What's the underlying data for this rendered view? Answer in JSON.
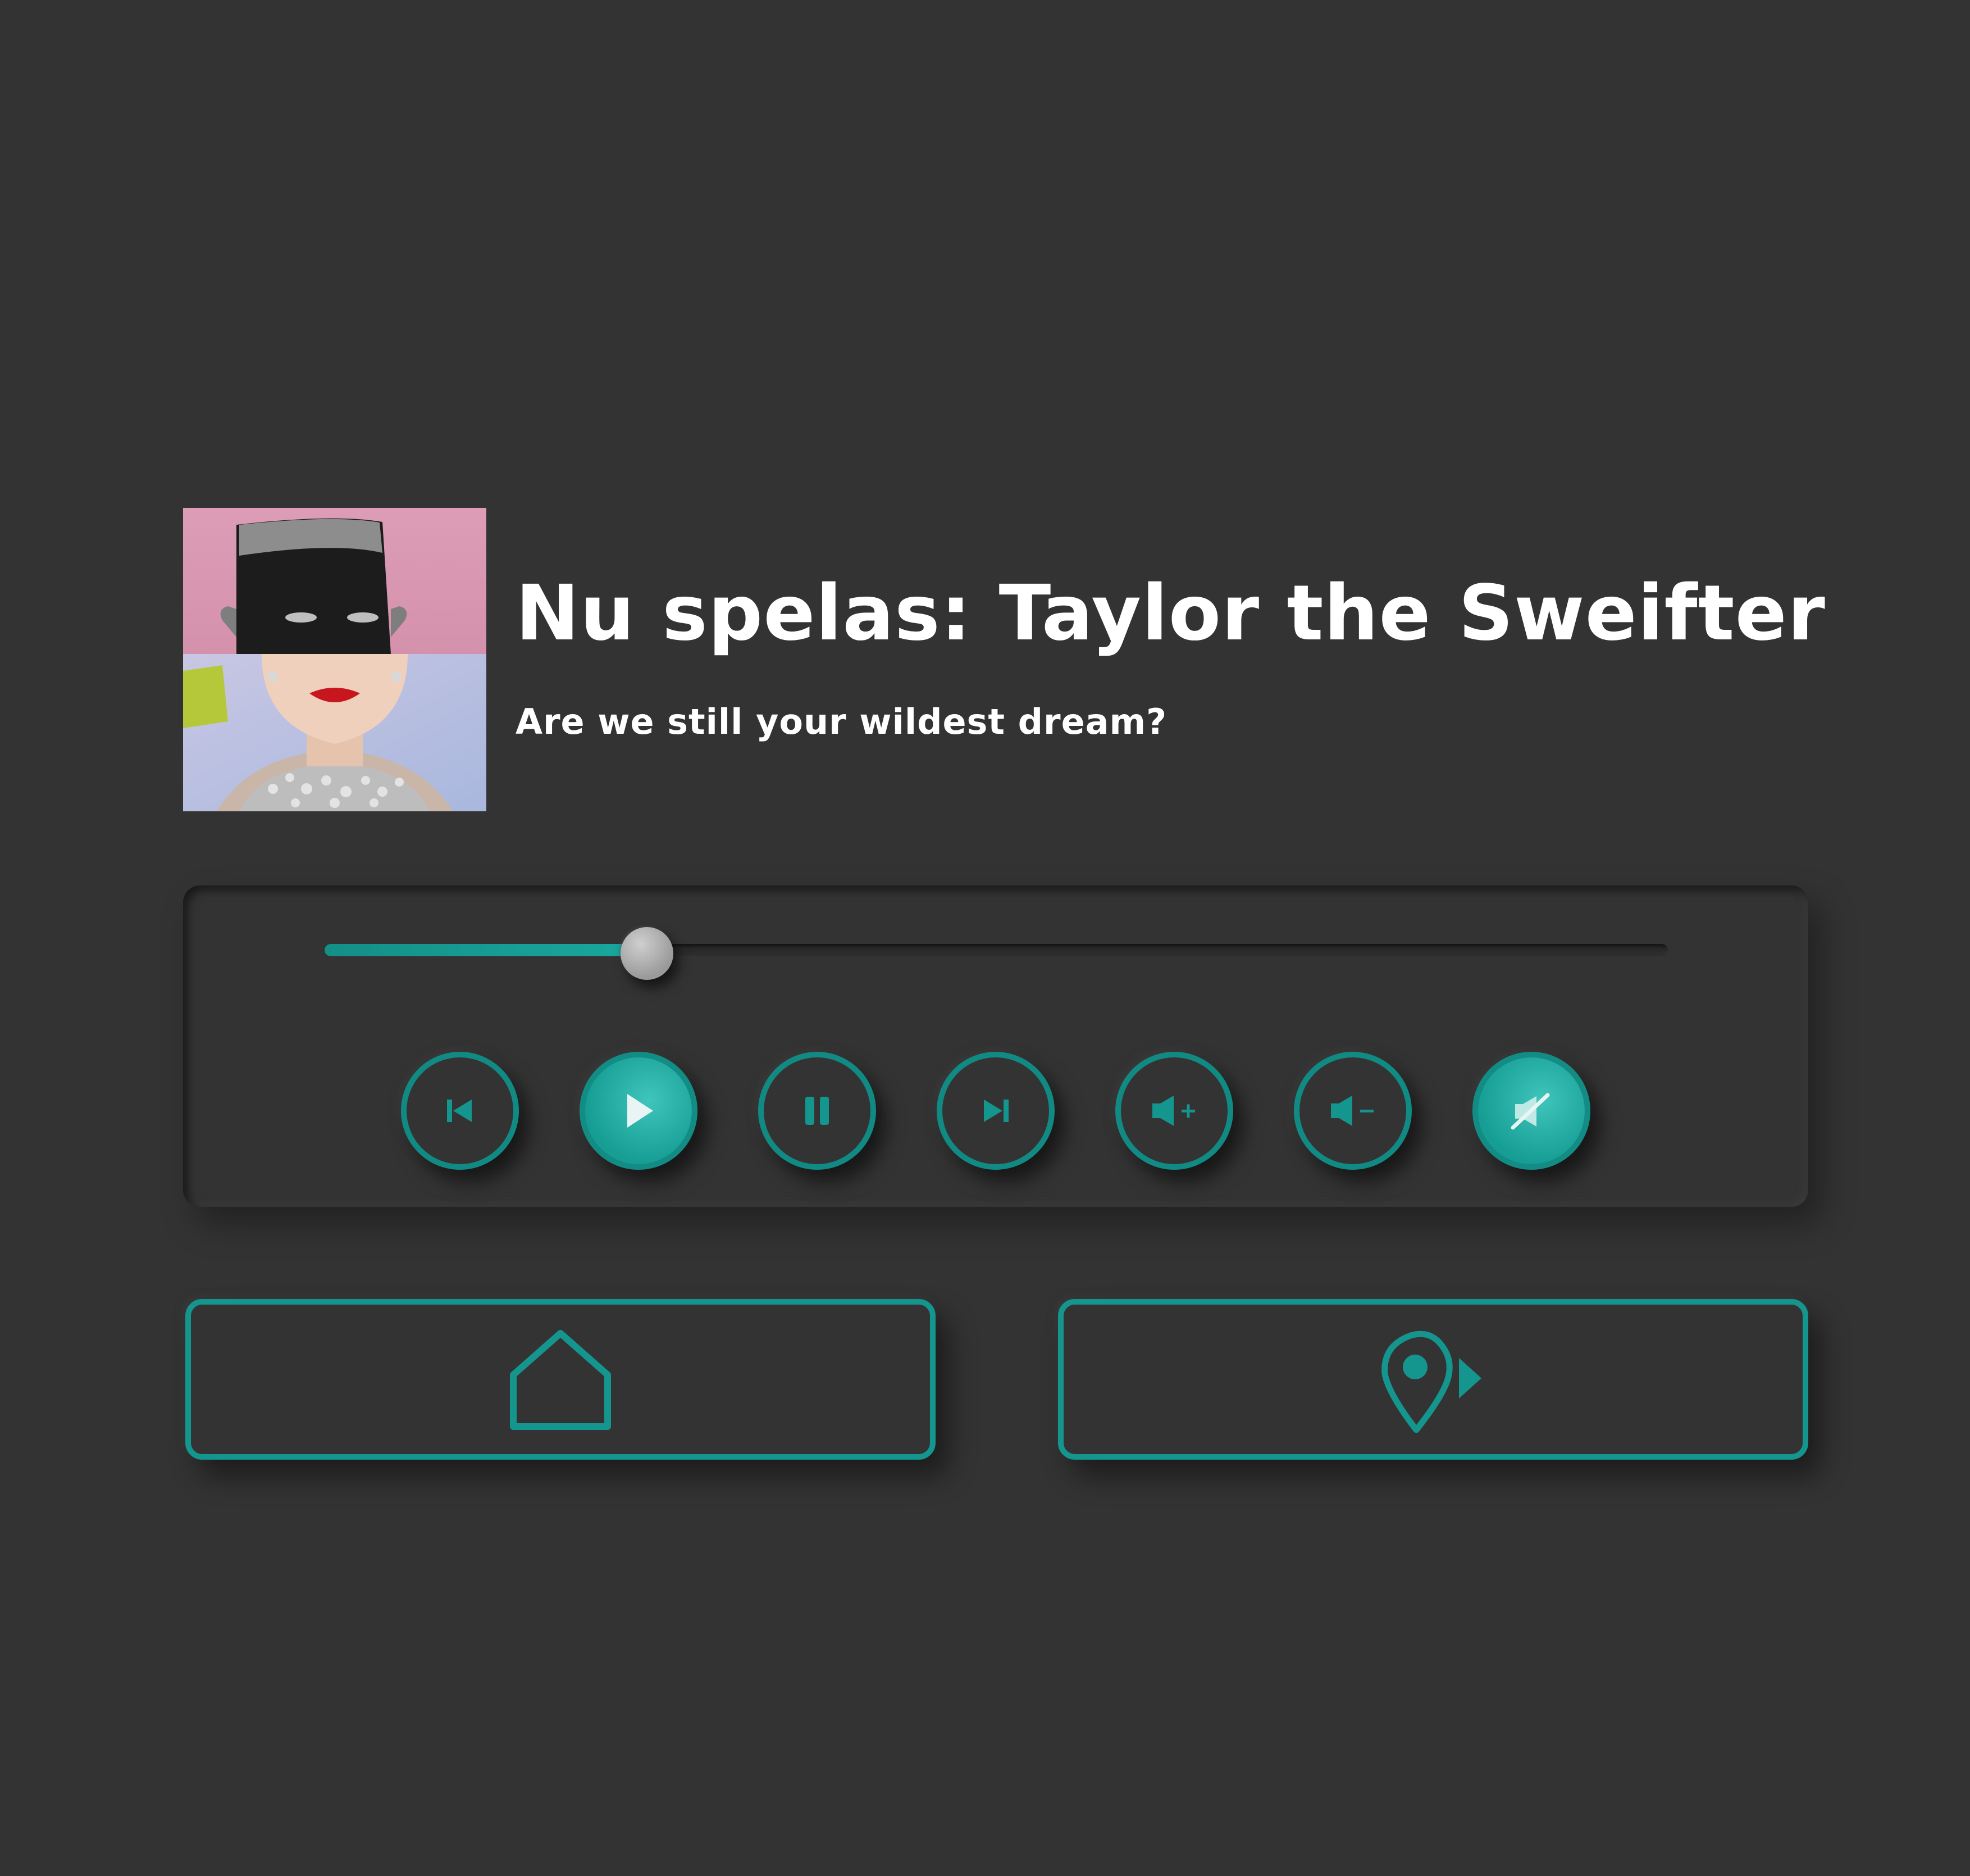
{
  "now_playing": {
    "title": "Nu spelas: Taylor the Sweifter",
    "subtitle": "Are we still your wildest dream?",
    "album_art_icon": "album-art-image"
  },
  "player": {
    "progress": 0.24,
    "accent_color": "#1aa89e",
    "controls": [
      {
        "name": "previous",
        "icon": "skip-previous-icon",
        "filled": false
      },
      {
        "name": "play",
        "icon": "play-icon",
        "filled": true
      },
      {
        "name": "pause",
        "icon": "pause-icon",
        "filled": false
      },
      {
        "name": "next",
        "icon": "skip-next-icon",
        "filled": false
      },
      {
        "name": "volume-up",
        "icon": "volume-up-icon",
        "filled": false
      },
      {
        "name": "volume-down",
        "icon": "volume-down-icon",
        "filled": false
      },
      {
        "name": "mute",
        "icon": "mute-icon",
        "filled": true
      }
    ]
  },
  "navigation": {
    "home_icon": "home-icon",
    "location_icon": "location-navigate-icon"
  },
  "colors": {
    "background": "#333333",
    "accent": "#1aa89e",
    "text": "#ffffff"
  }
}
